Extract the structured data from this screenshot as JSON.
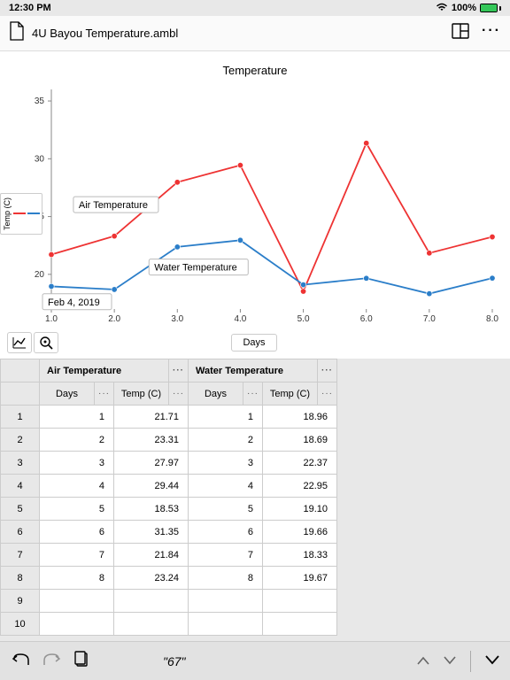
{
  "status": {
    "time": "12:30 PM",
    "wifi": "wifi",
    "battery_pct": "100%"
  },
  "toolbar": {
    "filename": "4U Bayou Temperature.ambl"
  },
  "chart": {
    "title": "Temperature",
    "ylabel": "Temp (C)",
    "xlabel": "Days",
    "ann_air": "Air Temperature",
    "ann_water": "Water Temperature",
    "ann_date": "Feb 4, 2019",
    "yticks": [
      "20",
      "25",
      "30",
      "35"
    ],
    "xticks": [
      "1.0",
      "2.0",
      "3.0",
      "4.0",
      "5.0",
      "6.0",
      "7.0",
      "8.0"
    ]
  },
  "table": {
    "group_air": "Air Temperature",
    "group_water": "Water Temperature",
    "col_days": "Days",
    "col_temp": "Temp (C)",
    "dots": "···",
    "rows": [
      {
        "n": "1",
        "ad": "1",
        "at": "21.71",
        "wd": "1",
        "wt": "18.96"
      },
      {
        "n": "2",
        "ad": "2",
        "at": "23.31",
        "wd": "2",
        "wt": "18.69"
      },
      {
        "n": "3",
        "ad": "3",
        "at": "27.97",
        "wd": "3",
        "wt": "22.37"
      },
      {
        "n": "4",
        "ad": "4",
        "at": "29.44",
        "wd": "4",
        "wt": "22.95"
      },
      {
        "n": "5",
        "ad": "5",
        "at": "18.53",
        "wd": "5",
        "wt": "19.10"
      },
      {
        "n": "6",
        "ad": "6",
        "at": "31.35",
        "wd": "6",
        "wt": "19.66"
      },
      {
        "n": "7",
        "ad": "7",
        "at": "21.84",
        "wd": "7",
        "wt": "18.33"
      },
      {
        "n": "8",
        "ad": "8",
        "at": "23.24",
        "wd": "8",
        "wt": "19.67"
      },
      {
        "n": "9",
        "ad": "",
        "at": "",
        "wd": "",
        "wt": ""
      },
      {
        "n": "10",
        "ad": "",
        "at": "",
        "wd": "",
        "wt": ""
      }
    ]
  },
  "bottombar": {
    "search": "\"67\""
  },
  "chart_data": {
    "type": "line",
    "title": "Temperature",
    "xlabel": "Days",
    "ylabel": "Temp (C)",
    "x": [
      1,
      2,
      3,
      4,
      5,
      6,
      7,
      8
    ],
    "ylim": [
      17,
      36
    ],
    "xlim": [
      1,
      8
    ],
    "series": [
      {
        "name": "Air Temperature",
        "color": "#e33",
        "values": [
          21.71,
          23.31,
          27.97,
          29.44,
          18.53,
          31.35,
          21.84,
          23.24
        ]
      },
      {
        "name": "Water Temperature",
        "color": "#2b7ec9",
        "values": [
          18.96,
          18.69,
          22.37,
          22.95,
          19.1,
          19.66,
          18.33,
          19.67
        ]
      }
    ],
    "annotations": [
      {
        "text": "Air Temperature",
        "x": 1.6,
        "y": 26
      },
      {
        "text": "Water Temperature",
        "x": 3.3,
        "y": 20.5
      },
      {
        "text": "Feb 4, 2019",
        "x": 1.3,
        "y": 17.5
      }
    ]
  }
}
